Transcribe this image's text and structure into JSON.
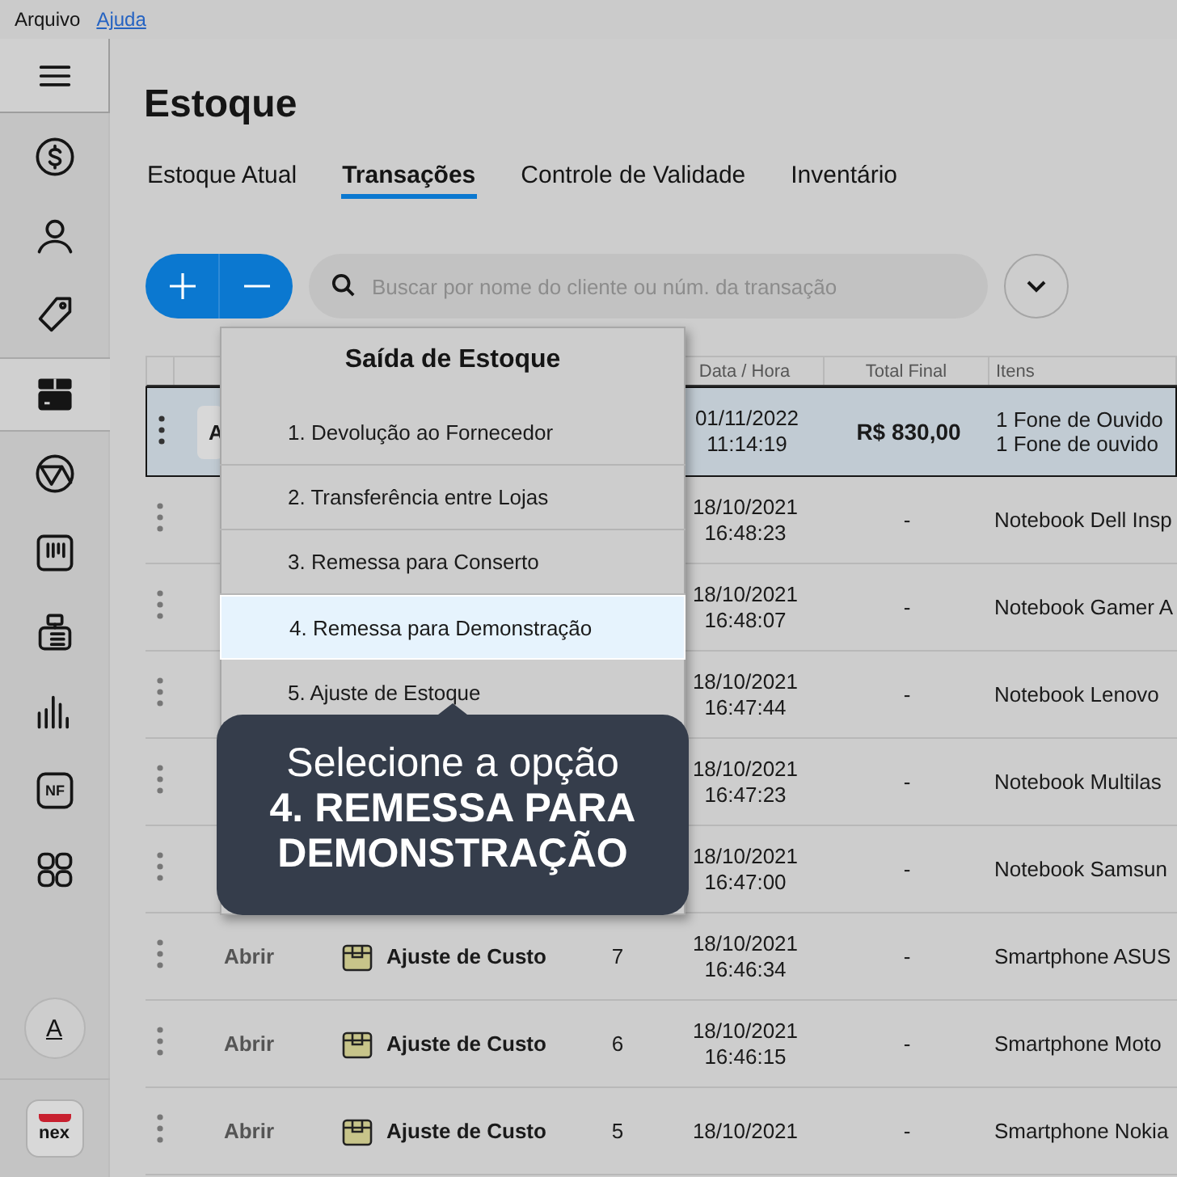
{
  "menubar": [
    {
      "label": "Arquivo",
      "kind": "menu"
    },
    {
      "label": "Ajuda",
      "kind": "link"
    }
  ],
  "sidebar": {
    "items": [
      {
        "selected": false
      },
      {
        "selected": false
      },
      {
        "selected": false
      },
      {
        "selected": true
      },
      {
        "selected": false
      },
      {
        "selected": false
      },
      {
        "selected": false
      },
      {
        "selected": false
      },
      {
        "label": "NF",
        "selected": false
      },
      {
        "selected": false
      }
    ],
    "user": {
      "initial": "A"
    },
    "logo": {
      "label": "nex"
    }
  },
  "page": {
    "title": "Estoque"
  },
  "tabs": [
    {
      "label": "Estoque Atual",
      "selected": false
    },
    {
      "label": "Transações",
      "selected": true
    },
    {
      "label": "Controle de Validade",
      "selected": false
    },
    {
      "label": "Inventário",
      "selected": false
    }
  ],
  "toolbar": {
    "search": {
      "placeholder": "Buscar por nome do cliente ou núm. da transação"
    }
  },
  "table": {
    "columns": [
      "Data / Hora",
      "Total Final",
      "Itens"
    ],
    "rows": [
      {
        "selected": true,
        "open": "A",
        "date": "01/11/2022",
        "time": "11:14:19",
        "total": "R$ 830,00",
        "items": [
          "1  Fone de Ouvido",
          "1  Fone de ouvido"
        ]
      },
      {
        "selected": false,
        "date": "18/10/2021",
        "time": "16:48:23",
        "total": "-",
        "items": [
          "Notebook Dell Insp"
        ]
      },
      {
        "selected": false,
        "date": "18/10/2021",
        "time": "16:48:07",
        "total": "-",
        "items": [
          "Notebook Gamer A"
        ]
      },
      {
        "selected": false,
        "date": "18/10/2021",
        "time": "16:47:44",
        "total": "-",
        "items": [
          "Notebook Lenovo"
        ]
      },
      {
        "selected": false,
        "date": "18/10/2021",
        "time": "16:47:23",
        "total": "-",
        "items": [
          "Notebook Multilas"
        ]
      },
      {
        "selected": false,
        "date": "18/10/2021",
        "time": "16:47:00",
        "total": "-",
        "items": [
          "Notebook Samsun"
        ]
      },
      {
        "selected": false,
        "open": "Abrir",
        "type": "Ajuste de Custo",
        "number": "7",
        "date": "18/10/2021",
        "time": "16:46:34",
        "total": "-",
        "items": [
          "Smartphone ASUS"
        ]
      },
      {
        "selected": false,
        "open": "Abrir",
        "type": "Ajuste de Custo",
        "number": "6",
        "date": "18/10/2021",
        "time": "16:46:15",
        "total": "-",
        "items": [
          "Smartphone Moto"
        ]
      },
      {
        "selected": false,
        "open": "Abrir",
        "type": "Ajuste de Custo",
        "number": "5",
        "date": "18/10/2021",
        "total": "-",
        "items": [
          "Smartphone Nokia"
        ]
      }
    ]
  },
  "popup": {
    "title": "Saída de Estoque",
    "items": [
      {
        "label": "1. Devolução ao Fornecedor",
        "selected": false
      },
      {
        "label": "2. Transferência entre Lojas",
        "selected": false
      },
      {
        "label": "3. Remessa para Conserto",
        "selected": false
      },
      {
        "label": "4. Remessa para Demonstração",
        "selected": true
      },
      {
        "label": "5. Ajuste de Estoque",
        "selected": false
      }
    ]
  },
  "tooltip": {
    "text": "Selecione a opção",
    "emphasis": "4. REMESSA PARA DEMONSTRAÇÃO"
  }
}
